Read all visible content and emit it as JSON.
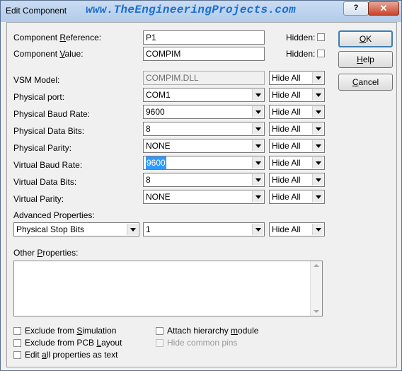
{
  "window": {
    "title": "Edit Component",
    "watermark": "www.TheEngineeringProjects.com",
    "help_button": "?",
    "close_button": "✕"
  },
  "fields": {
    "component_reference": {
      "label_pre": "Component ",
      "label_u": "R",
      "label_post": "eference:",
      "value": "P1",
      "hidden_label": "Hidden:"
    },
    "component_value": {
      "label_pre": "Component ",
      "label_u": "V",
      "label_post": "alue:",
      "value": "COMPIM",
      "hidden_label": "Hidden:"
    }
  },
  "properties": [
    {
      "label": "VSM Model:",
      "value": "COMPIM.DLL",
      "visibility": "Hide All",
      "readonly": true
    },
    {
      "label": "Physical port:",
      "value": "COM1",
      "visibility": "Hide All"
    },
    {
      "label": "Physical Baud Rate:",
      "value": "9600",
      "visibility": "Hide All"
    },
    {
      "label": "Physical Data Bits:",
      "value": "8",
      "visibility": "Hide All"
    },
    {
      "label": "Physical Parity:",
      "value": "NONE",
      "visibility": "Hide All"
    },
    {
      "label": "Virtual Baud Rate:",
      "value": "9600",
      "visibility": "Hide All"
    },
    {
      "label": "Virtual Data Bits:",
      "value": "8",
      "visibility": "Hide All"
    },
    {
      "label": "Virtual Parity:",
      "value": "NONE",
      "visibility": "Hide All"
    }
  ],
  "advanced": {
    "label": "Advanced Properties:",
    "property": "Physical Stop Bits",
    "value": "1",
    "visibility": "Hide All"
  },
  "other": {
    "label_pre": "Other ",
    "label_u": "P",
    "label_post": "roperties:"
  },
  "checks": {
    "exclude_sim": {
      "pre": "Exclude from ",
      "u": "S",
      "post": "imulation"
    },
    "exclude_pcb": {
      "pre": "Exclude from PCB ",
      "u": "L",
      "post": "ayout"
    },
    "edit_all": {
      "pre": "Edit ",
      "u": "a",
      "post": "ll properties as text"
    },
    "attach": {
      "pre": "Attach hierarchy ",
      "u": "m",
      "post": "odule"
    },
    "hide_pins": {
      "label": "Hide common pins"
    }
  },
  "buttons": {
    "ok": {
      "u": "O",
      "post": "K"
    },
    "help": {
      "u": "H",
      "post": "elp"
    },
    "cancel": {
      "u": "C",
      "post": "ancel"
    }
  }
}
